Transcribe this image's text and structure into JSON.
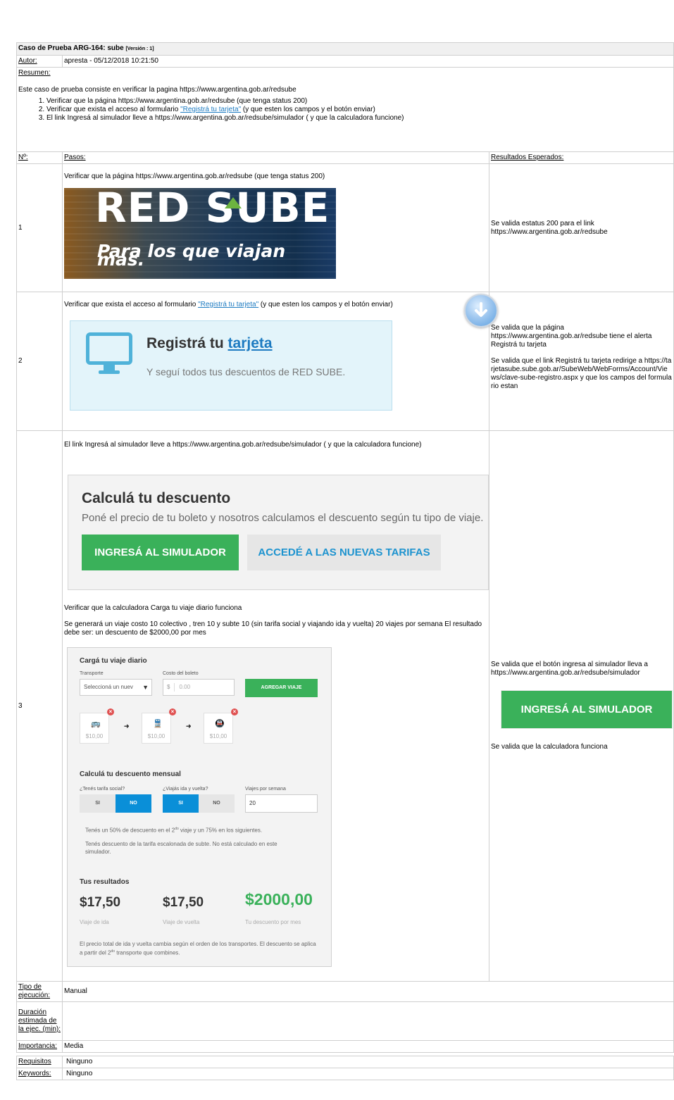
{
  "header": {
    "title": "Caso de Prueba ARG-164: sube",
    "version": "[Versión : 1]",
    "author_label": "Autor:",
    "author_value": "apresta - 05/12/2018 10:21:50",
    "summary_label": "Resumen:",
    "summary_text": "Este caso de prueba consiste en verificar la pagina https://www.argentina.gob.ar/redsube",
    "summary_items": [
      {
        "pre": "Verificar que la página https://www.argentina.gob.ar/redsube (que tenga status 200)",
        "link": "",
        "post": ""
      },
      {
        "pre": "Verificar que exista el acceso al formulario ",
        "link": "\"Registrá tu tarjeta\"",
        "post": " (y que esten los campos y el botón enviar)"
      },
      {
        "pre": "El link Ingresá al simulador lleve a https://www.argentina.gob.ar/redsube/simulador ( y que la calculadora funcione)",
        "link": "",
        "post": ""
      }
    ]
  },
  "columns": {
    "num": "Nº:",
    "steps": "Pasos:",
    "expected": "Resultados Esperados:"
  },
  "steps": [
    {
      "num": "1",
      "text": "Verificar que la página https://www.argentina.gob.ar/redsube (que tenga status 200)",
      "banner_title": "RED SUBE",
      "banner_subtitle": "Para los que viajan más.",
      "expected": "Se valida estatus 200 para el link https://www.argentina.gob.ar/redsube"
    },
    {
      "num": "2",
      "text_pre": "Verificar que exista el acceso al formulario ",
      "text_link": "\"Registrá tu tarjeta\"",
      "text_post": " (y que esten los campos y el botón enviar)",
      "card_title": "Registrá tu ",
      "card_title_link": "tarjeta",
      "card_subtitle": "Y seguí todos tus descuentos de RED SUBE.",
      "expected_1": "Se valida que la página https://www.argentina.gob.ar/redsube tiene el alerta Registrá tu tarjeta",
      "expected_2": "Se valida que el link Registrá tu tarjeta redirige a https://tarjetasube.sube.gob.ar/SubeWeb/WebForms/Account/Views/clave-sube-registro.aspx y que los campos del formulario estan"
    },
    {
      "num": "3",
      "text": "El link Ingresá al simulador lleve a https://www.argentina.gob.ar/redsube/simulador ( y que la calculadora funcione)",
      "calc_title": "Calculá tu descuento",
      "calc_subtitle": "Poné el precio de tu boleto y nosotros calculamos el descuento según tu tipo de viaje.",
      "calc_btn_1": "INGRESÁ AL SIMULADOR",
      "calc_btn_2": "ACCEDÉ A LAS NUEVAS TARIFAS",
      "text_2": "Verificar que la calculadora Carga tu viaje diario funciona",
      "text_3": "Se generará un viaje costo 10 colectivo , tren 10 y subte 10 (sin tarifa social y viajando ida y vuelta) 20 viajes por semana El resultado debe ser: un descuento de $2000,00 por mes",
      "expected_1": "Se valida que el botón ingresa al simulador lleva a https://www.argentina.gob.ar/redsube/simulador",
      "expected_button": "INGRESÁ AL SIMULADOR",
      "expected_2": "Se valida que la calculadora funciona"
    }
  ],
  "simulator": {
    "title": "Cargá tu viaje diario",
    "transport_label": "Transporte",
    "transport_value": "Seleccioná un nuev",
    "cost_label": "Costo del boleto",
    "currency": "$",
    "cost_placeholder": "0.00",
    "add_button": "AGREGAR VIAJE",
    "trips": [
      {
        "icon": "bus-icon",
        "price": "$10,00"
      },
      {
        "icon": "train-icon",
        "price": "$10,00"
      },
      {
        "icon": "subway-icon",
        "price": "$10,00"
      }
    ],
    "monthly_title": "Calculá tu descuento mensual",
    "social_label": "¿Tenés tarifa social?",
    "social_si": "SI",
    "social_no": "NO",
    "round_label": "¿Viajás ida y vuelta?",
    "round_si": "SI",
    "round_no": "NO",
    "trips_week_label": "Viajes por semana",
    "trips_week_value": "20",
    "note_1_a": "Tenés un 50% de descuento en el 2",
    "note_1_sup": "do",
    "note_1_b": " viaje y un 75% en los siguientes.",
    "note_2": "Tenés descuento de la tarifa escalonada de subte. No está calculado en este simulador.",
    "results_title": "Tus resultados",
    "result_ida": "$17,50",
    "result_ida_label": "Viaje de ida",
    "result_vuelta": "$17,50",
    "result_vuelta_label": "Viaje de vuelta",
    "result_discount": "$2000,00",
    "result_discount_label": "Tu descuento por mes",
    "footer_a": "El precio total de ida y vuelta cambia según el orden de los transportes. El descuento se aplica a partir del 2",
    "footer_sup": "do",
    "footer_b": " transporte que combines.",
    "colors": {
      "green": "#3ab15a",
      "blue": "#0a8fd8",
      "error": "#e05252"
    }
  },
  "footer": {
    "exec_type_label": "Tipo de ejecución:",
    "exec_type_value": "Manual",
    "duration_label": "Duración estimada de la ejec. (min):",
    "duration_value": "",
    "importance_label": "Importancia:",
    "importance_value": "Media",
    "requirements_label": "Requisitos",
    "requirements_value": "Ninguno",
    "keywords_label": "Keywords:",
    "keywords_value": "Ninguno"
  }
}
